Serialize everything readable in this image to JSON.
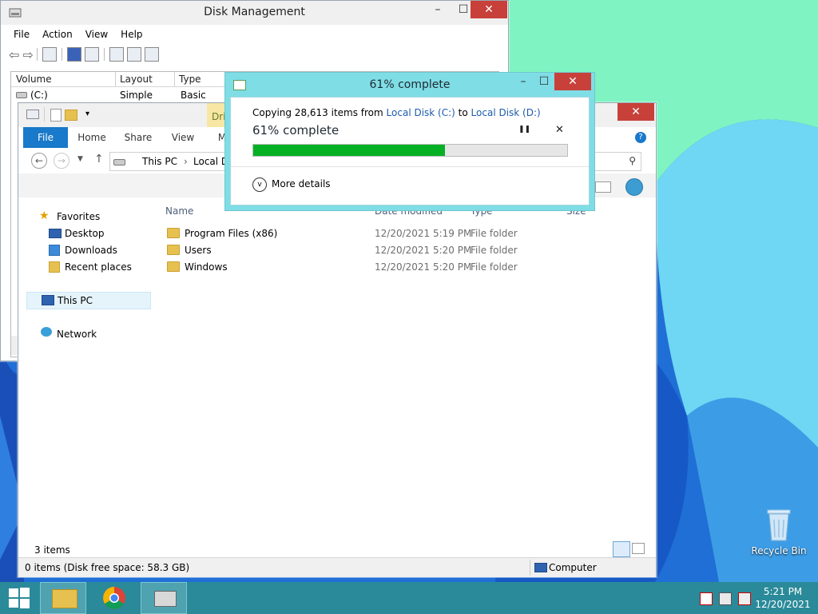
{
  "disk_mgmt": {
    "title": "Disk Management",
    "menu": [
      "File",
      "Action",
      "View",
      "Help"
    ],
    "columns": [
      "Volume",
      "Layout",
      "Type"
    ],
    "rows": [
      {
        "volume": "(C:)",
        "layout": "Simple",
        "type": "Basic"
      }
    ]
  },
  "explorer": {
    "ribbon_tabs": [
      "File",
      "Home",
      "Share",
      "View",
      "M"
    ],
    "drive_tools_tab": "Dri",
    "breadcrumb": [
      "This PC",
      "Local Di"
    ],
    "nav": {
      "favorites": "Favorites",
      "favorites_items": [
        "Desktop",
        "Downloads",
        "Recent places"
      ],
      "this_pc": "This PC",
      "network": "Network"
    },
    "columns": {
      "name": "Name",
      "date": "Date modified",
      "type": "Type",
      "size": "Size"
    },
    "files": [
      {
        "name": "Program Files (x86)",
        "date": "12/20/2021 5:19 PM",
        "type": "File folder"
      },
      {
        "name": "Users",
        "date": "12/20/2021 5:20 PM",
        "type": "File folder"
      },
      {
        "name": "Windows",
        "date": "12/20/2021 5:20 PM",
        "type": "File folder"
      }
    ],
    "items_count": "3 items",
    "status_left": "0 items (Disk free space: 58.3 GB)",
    "status_right": "Computer"
  },
  "copy_dialog": {
    "title": "61% complete",
    "copy_prefix": "Copying 28,613 items from",
    "source": "Local Disk (C:)",
    "to_word": "to",
    "dest": "Local Disk (D:)",
    "percent_text": "61% complete",
    "progress": 0.61,
    "more_details": "More details",
    "pause_glyph": "❚❚",
    "close_glyph": "✕"
  },
  "desktop": {
    "recycle_bin": "Recycle Bin"
  },
  "taskbar": {
    "time": "5:21 PM",
    "date": "12/20/2021"
  },
  "colors": {
    "accent": "#1979ca",
    "progress": "#06b025",
    "dialog_frame": "#7fdde6",
    "taskbar": "#2a8a99",
    "close_red": "#c7403a"
  }
}
